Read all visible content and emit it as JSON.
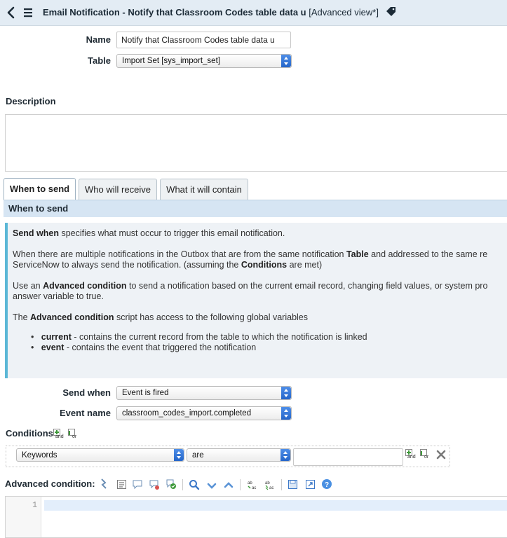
{
  "header": {
    "title": "Email Notification - Notify that Classroom Codes table data u",
    "view_suffix": "[Advanced view*]"
  },
  "form": {
    "name_label": "Name",
    "name_value": "Notify that Classroom Codes table data u",
    "table_label": "Table",
    "table_value": "Import Set [sys_import_set]",
    "description_label": "Description"
  },
  "tabs": [
    {
      "label": "When to send",
      "active": true
    },
    {
      "label": "Who will receive",
      "active": false
    },
    {
      "label": "What it will contain",
      "active": false
    }
  ],
  "section": {
    "title": "When to send"
  },
  "info": {
    "p1_bold": "Send when",
    "p1_rest": " specifies what must occur to trigger this email notification.",
    "p2_line1_a": "When there are multiple notifications in the Outbox that are from the same notification ",
    "p2_line1_bold": "Table",
    "p2_line1_b": " and addressed to the same re",
    "p2_line2_a": "ServiceNow to always send the notification. (assuming the ",
    "p2_line2_bold": "Conditions",
    "p2_line2_b": " are met)",
    "p3_line1_a": "Use an ",
    "p3_line1_bold": "Advanced condition",
    "p3_line1_b": " to send a notification based on the current email record, changing field values, or system pro",
    "p3_line2": "answer variable to true.",
    "p4_a": "The ",
    "p4_bold": "Advanced condition",
    "p4_b": " script has access to the following global variables",
    "bullets": [
      {
        "bold": "current",
        "rest": " - contains the current record from the table to which the notification is linked"
      },
      {
        "bold": "event",
        "rest": " - contains the event that triggered the notification"
      }
    ]
  },
  "send_when": {
    "label": "Send when",
    "value": "Event is fired"
  },
  "event_name": {
    "label": "Event name",
    "value": "classroom_codes_import.completed"
  },
  "conditions": {
    "label": "Conditions",
    "and_label": "and",
    "or_label": "or",
    "field_value": "Keywords",
    "operator_value": "are",
    "value_value": ""
  },
  "advanced": {
    "label": "Advanced condition:",
    "line_number": "1"
  },
  "colors": {
    "header_bg": "#e3ecf4",
    "section_bg": "#d6e5f3",
    "info_accent": "#5bb7d6",
    "select_arrow": "#2f72d6",
    "add_icon": "#3f9a3a"
  }
}
